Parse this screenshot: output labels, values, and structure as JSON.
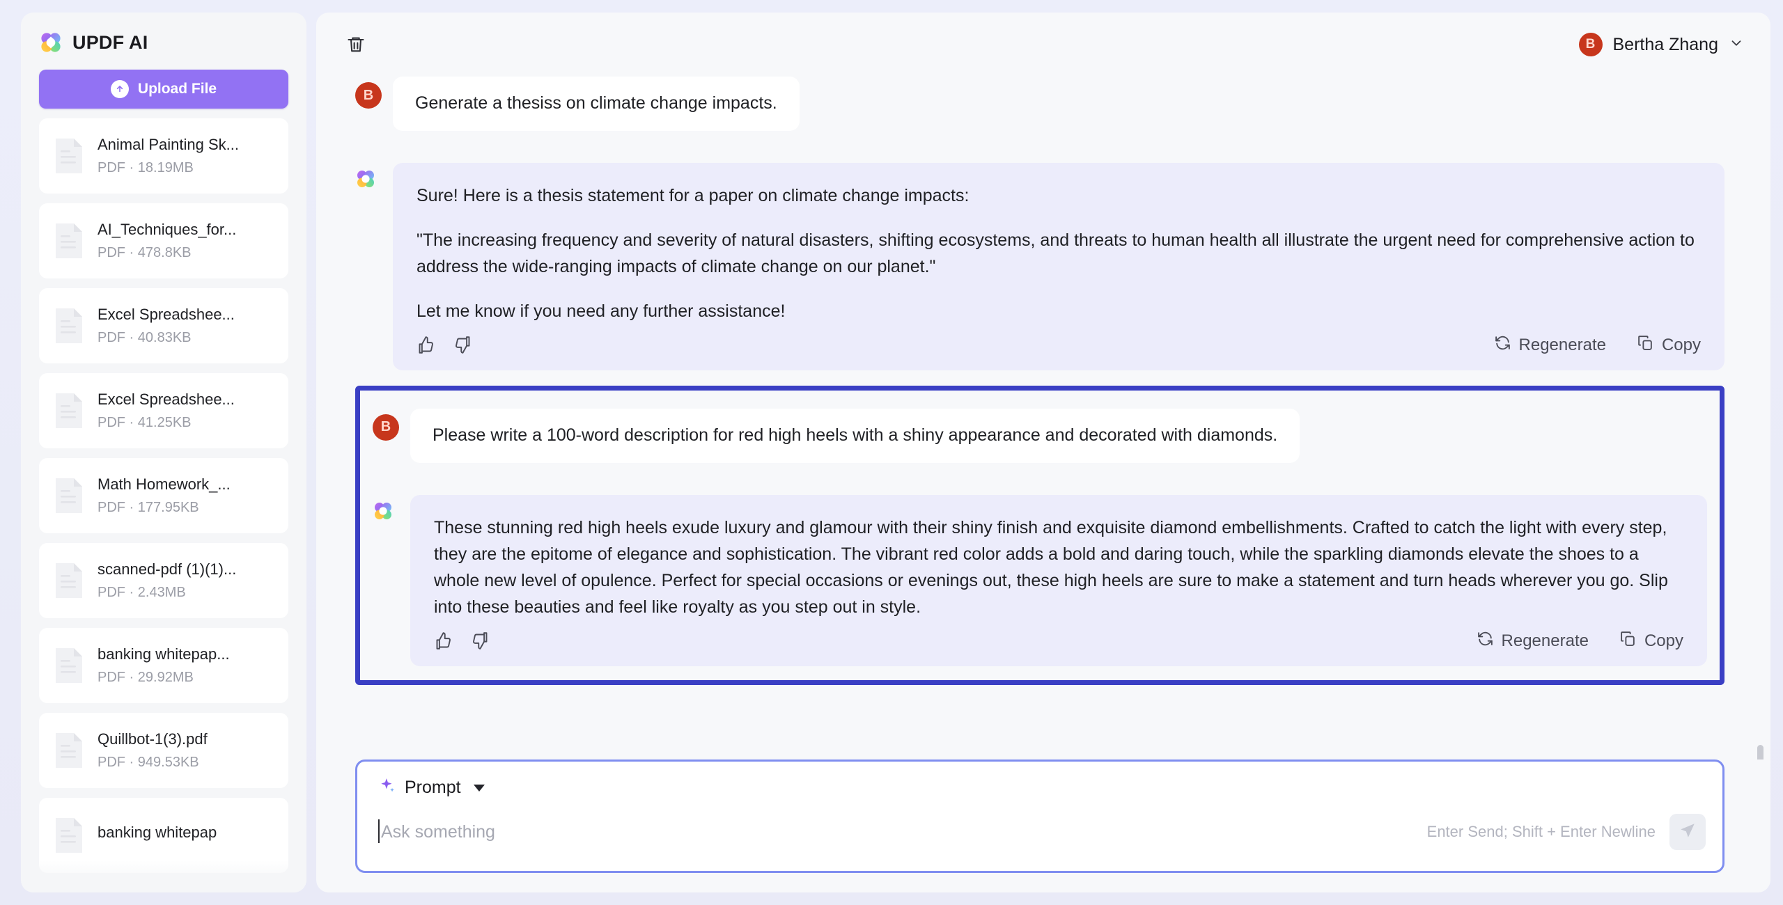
{
  "sidebar": {
    "brand": "UPDF AI",
    "brand_icon": "updf-clover-logo-icon",
    "upload_label": "Upload File",
    "upload_icon": "upload-arrow-icon",
    "files": [
      {
        "name": "Animal Painting Sk...",
        "meta": "PDF · 18.19MB",
        "icon": "pdf-document-icon"
      },
      {
        "name": "AI_Techniques_for...",
        "meta": "PDF · 478.8KB",
        "icon": "pdf-document-icon"
      },
      {
        "name": "Excel Spreadshee...",
        "meta": "PDF · 40.83KB",
        "icon": "pdf-document-icon"
      },
      {
        "name": "Excel Spreadshee...",
        "meta": "PDF · 41.25KB",
        "icon": "pdf-document-icon"
      },
      {
        "name": "Math Homework_...",
        "meta": "PDF · 177.95KB",
        "icon": "pdf-document-icon"
      },
      {
        "name": "scanned-pdf (1)(1)...",
        "meta": "PDF · 2.43MB",
        "icon": "pdf-document-icon"
      },
      {
        "name": "banking whitepap...",
        "meta": "PDF · 29.92MB",
        "icon": "pdf-document-icon"
      },
      {
        "name": "Quillbot-1(3).pdf",
        "meta": "PDF · 949.53KB",
        "icon": "pdf-document-icon"
      },
      {
        "name": "banking whitepap",
        "meta": "",
        "icon": "pdf-document-icon"
      }
    ]
  },
  "header": {
    "delete_icon": "trash-icon",
    "user_initial": "B",
    "user_name": "Bertha Zhang",
    "caret_icon": "chevron-down-icon"
  },
  "chat": {
    "turn1_user": {
      "initial": "B",
      "text": "Generate a thesiss on climate change impacts."
    },
    "turn1_ai": {
      "icon": "updf-clover-logo-icon",
      "p1": "Sure! Here is a thesis statement for a paper on climate change impacts:",
      "p2": "\"The increasing frequency and severity of natural disasters, shifting ecosystems, and threats to human health all illustrate the urgent need for comprehensive action to address the wide-ranging impacts of climate change on our planet.\"",
      "p3": "Let me know if you need any further assistance!"
    },
    "turn2_user": {
      "initial": "B",
      "text": "Please write a 100-word description for red high heels with a shiny appearance and decorated with diamonds."
    },
    "turn2_ai": {
      "icon": "updf-clover-logo-icon",
      "p1": "These stunning red high heels exude luxury and glamour with their shiny finish and exquisite diamond embellishments. Crafted to catch the light with every step, they are the epitome of elegance and sophistication. The vibrant red color adds a bold and daring touch, while the sparkling diamonds elevate the shoes to a whole new level of opulence. Perfect for special occasions or evenings out, these high heels are sure to make a statement and turn heads wherever you go. Slip into these beauties and feel like royalty as you step out in style."
    },
    "actions": {
      "like_icon": "thumbs-up-icon",
      "dislike_icon": "thumbs-down-icon",
      "regenerate_label": "Regenerate",
      "regenerate_icon": "refresh-icon",
      "copy_label": "Copy",
      "copy_icon": "copy-icon"
    }
  },
  "composer": {
    "prompt_label": "Prompt",
    "prompt_icon": "sparkle-icon",
    "dropdown_icon": "caret-down-icon",
    "placeholder": "Ask something",
    "send_hint": "Enter Send; Shift + Enter Newline",
    "send_icon": "send-paper-plane-icon"
  },
  "colors": {
    "accent_purple": "#9272f3",
    "highlight_border": "#3a3fc4",
    "ai_bubble": "#ececfb",
    "avatar_red": "#c7361c",
    "composer_border": "#7f8ef0"
  }
}
